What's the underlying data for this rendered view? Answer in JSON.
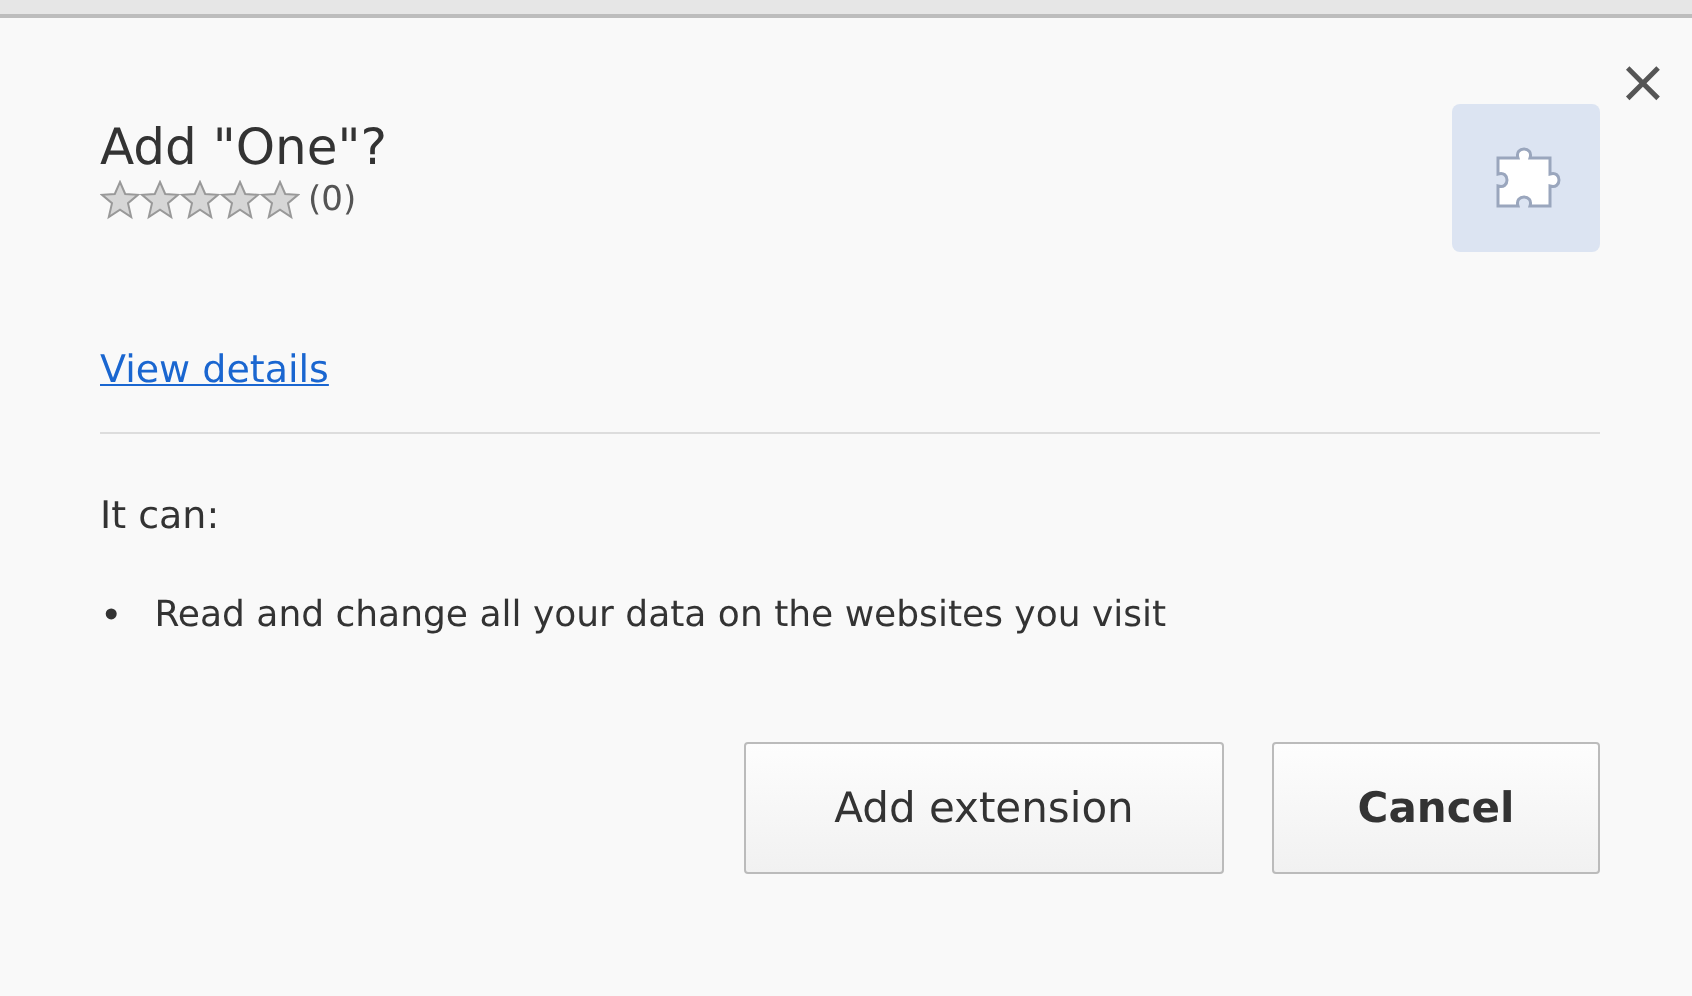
{
  "dialog": {
    "title": "Add \"One\"?",
    "close": "×",
    "rating": {
      "stars": 0,
      "count": "(0)"
    },
    "details_link": "View details",
    "permissions_heading": "It can:",
    "permissions": [
      {
        "bullet": "•",
        "text": "Read and change all your data on the websites you visit"
      }
    ],
    "buttons": [
      {
        "label": "Add extension",
        "default": false
      },
      {
        "label": "Cancel",
        "default": true
      }
    ]
  }
}
